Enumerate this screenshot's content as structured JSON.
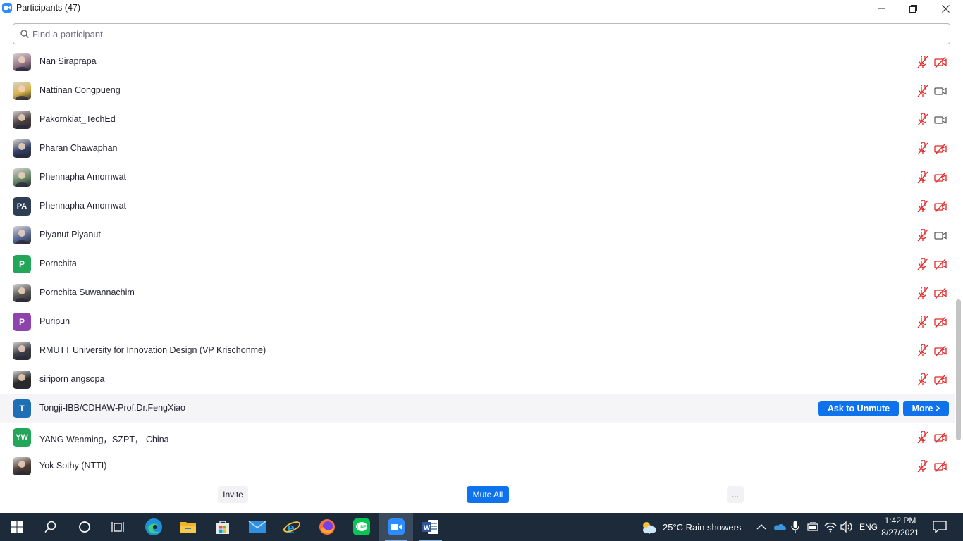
{
  "window": {
    "title": "Participants (47)",
    "controls": [
      "minimize",
      "restore",
      "close"
    ]
  },
  "search": {
    "placeholder": "Find a participant",
    "value": ""
  },
  "participants": [
    {
      "name": "Nan Siraprapa",
      "avatar_type": "photo",
      "avatar_color": "#9a7a8e",
      "mic": "muted",
      "video": "off"
    },
    {
      "name": "Nattinan Congpueng",
      "avatar_type": "photo",
      "avatar_color": "#d9b24a",
      "mic": "muted",
      "video": "on"
    },
    {
      "name": "Pakornkiat_TechEd",
      "avatar_type": "photo",
      "avatar_color": "#4a4040",
      "mic": "muted",
      "video": "on"
    },
    {
      "name": "Pharan Chawaphan",
      "avatar_type": "photo",
      "avatar_color": "#2f3e6a",
      "mic": "muted",
      "video": "off"
    },
    {
      "name": "Phennapha Amornwat",
      "avatar_type": "photo",
      "avatar_color": "#6a8a6a",
      "mic": "muted",
      "video": "off"
    },
    {
      "name": "Phennapha Amornwat",
      "avatar_type": "initials",
      "initials": "PA",
      "avatar_color": "#2d3e55",
      "mic": "muted",
      "video": "off"
    },
    {
      "name": "Piyanut Piyanut",
      "avatar_type": "photo",
      "avatar_color": "#5a6a9a",
      "mic": "muted",
      "video": "on"
    },
    {
      "name": "Pornchita",
      "avatar_type": "initials",
      "initials": "P",
      "avatar_color": "#23a55a",
      "mic": "muted",
      "video": "off"
    },
    {
      "name": "Pornchita Suwannachim",
      "avatar_type": "photo",
      "avatar_color": "#555555",
      "mic": "muted",
      "video": "off"
    },
    {
      "name": "Puripun",
      "avatar_type": "initials",
      "initials": "P",
      "avatar_color": "#8e44ad",
      "mic": "muted",
      "video": "off"
    },
    {
      "name": "RMUTT University for Innovation Design (VP Krischonme)",
      "avatar_type": "photo",
      "avatar_color": "#3c3c48",
      "mic": "muted",
      "video": "off"
    },
    {
      "name": "siriporn angsopa",
      "avatar_type": "photo",
      "avatar_color": "#2a2a2a",
      "mic": "muted",
      "video": "off"
    },
    {
      "name": "Tongji-IBB/CDHAW-Prof.Dr.FengXiao",
      "avatar_type": "initials",
      "initials": "T",
      "avatar_color": "#1f6fb5",
      "hovered": true,
      "actions": [
        "Ask to Unmute",
        "More"
      ]
    },
    {
      "name": "YANG Wenming，SZPT， China",
      "avatar_type": "initials",
      "initials": "YW",
      "avatar_color": "#23a55a",
      "mic": "muted",
      "video": "off"
    },
    {
      "name": "Yok Sothy (NTTI)",
      "avatar_type": "photo",
      "avatar_color": "#4d3c34",
      "mic": "muted",
      "video": "off"
    }
  ],
  "footer": {
    "invite_label": "Invite",
    "mute_all_label": "Mute All",
    "more_label": "..."
  },
  "taskbar": {
    "apps": [
      "start",
      "search",
      "cortana",
      "task-view",
      "edge",
      "file-explorer",
      "store",
      "mail",
      "internet-explorer",
      "firefox",
      "line",
      "zoom",
      "word"
    ],
    "active_app": "zoom",
    "weather": "25°C  Rain showers",
    "language": "ENG",
    "time": "1:42 PM",
    "date": "8/27/2021"
  },
  "colors": {
    "accent": "#0e72ed",
    "muted_red": "#e02828",
    "zoom_blue": "#2d8cff"
  }
}
